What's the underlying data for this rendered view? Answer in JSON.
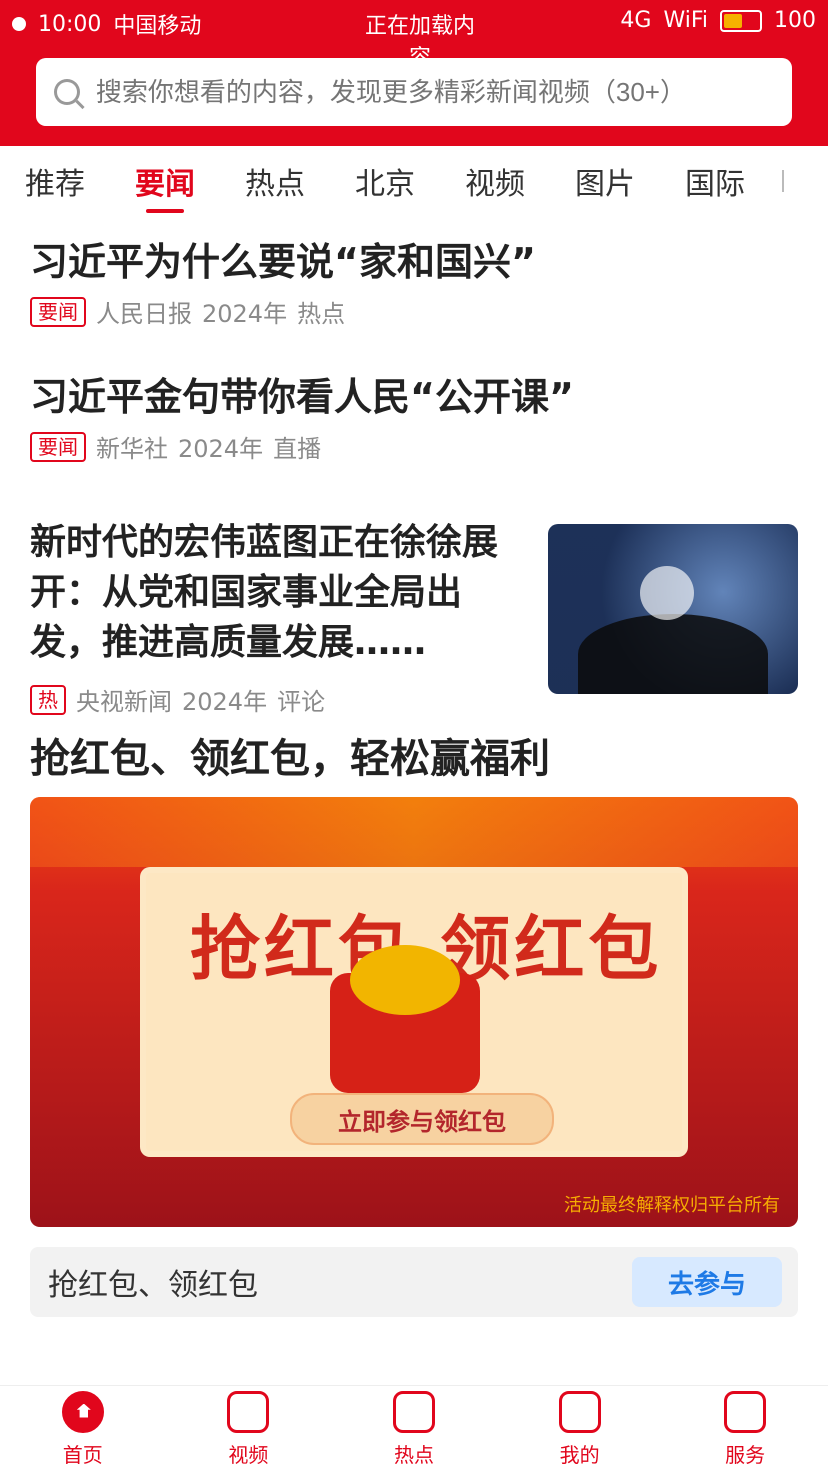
{
  "status_bar": {
    "left_time": "10:00",
    "left_carrier": "中国移动",
    "center_text": "正在加载内容",
    "right_signal": "4G",
    "right_wifi": "WiFi",
    "right_battery": "100"
  },
  "search": {
    "placeholder": "搜索你想看的内容，发现更多精彩新闻视频（30+）"
  },
  "tabs": {
    "items": [
      "推荐",
      "要闻",
      "热点",
      "北京",
      "视频",
      "图片",
      "国际"
    ],
    "active_index": 1
  },
  "articles": [
    {
      "title": "习近平为什么要说“家和国兴”",
      "badge": "要闻",
      "source": "人民日报",
      "time": "2024年",
      "extra": "热点"
    },
    {
      "title": "习近平金句带你看人民“公开课”",
      "badge": "要闻",
      "source": "新华社",
      "time": "2024年",
      "extra": "直播"
    },
    {
      "title": "新时代的宏伟蓝图正在徐徐展开：从党和国家事业全局出发，推进高质量发展……",
      "badge": "热",
      "source": "央视新闻",
      "time": "2024年",
      "extra": "评论"
    }
  ],
  "banner": {
    "title": "抢红包、领红包，轻松赢福利",
    "headline": "抢红包 领红包",
    "button": "立即参与领红包",
    "footer": "活动最终解释权归平台所有"
  },
  "cta": {
    "label": "抢红包、领红包",
    "button": "去参与"
  },
  "bottom_nav": {
    "items": [
      "首页",
      "视频",
      "热点",
      "我的",
      "服务"
    ]
  },
  "colors": {
    "primary": "#e1061c",
    "link": "#1e7ae6"
  }
}
